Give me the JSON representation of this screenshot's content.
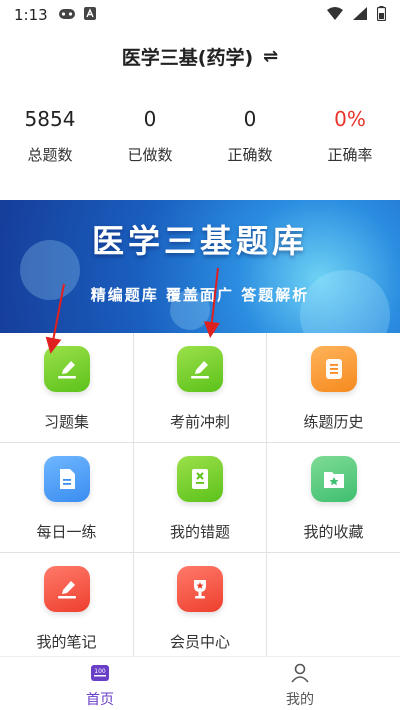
{
  "status_bar": {
    "time": "1:13",
    "icons": [
      "gamepad-icon",
      "a-badge-icon",
      "wifi-icon",
      "signal-icon",
      "battery-icon"
    ]
  },
  "header": {
    "title": "医学三基(药学)",
    "switch_icon": "⇌"
  },
  "stats": [
    {
      "value": "5854",
      "label": "总题数"
    },
    {
      "value": "0",
      "label": "已做数"
    },
    {
      "value": "0",
      "label": "正确数"
    },
    {
      "value": "0%",
      "label": "正确率"
    }
  ],
  "banner": {
    "title": "医学三基题库",
    "subtitle": "精编题库  覆盖面广  答题解析"
  },
  "menu": [
    {
      "label": "习题集",
      "icon": "pencil-card-icon"
    },
    {
      "label": "考前冲刺",
      "icon": "pencil-card-icon"
    },
    {
      "label": "练题历史",
      "icon": "scroll-icon"
    },
    {
      "label": "每日一练",
      "icon": "document-icon"
    },
    {
      "label": "我的错题",
      "icon": "error-book-icon"
    },
    {
      "label": "我的收藏",
      "icon": "star-folder-icon"
    },
    {
      "label": "我的笔记",
      "icon": "pencil-note-icon"
    },
    {
      "label": "会员中心",
      "icon": "trophy-icon"
    }
  ],
  "bottom_nav": [
    {
      "label": "首页",
      "icon": "home-100-icon",
      "active": true
    },
    {
      "label": "我的",
      "icon": "person-icon",
      "active": false
    }
  ],
  "colors": {
    "accent_red": "#e8332b",
    "nav_active": "#6a3fc7",
    "annotation_arrow": "#e01f1f"
  }
}
